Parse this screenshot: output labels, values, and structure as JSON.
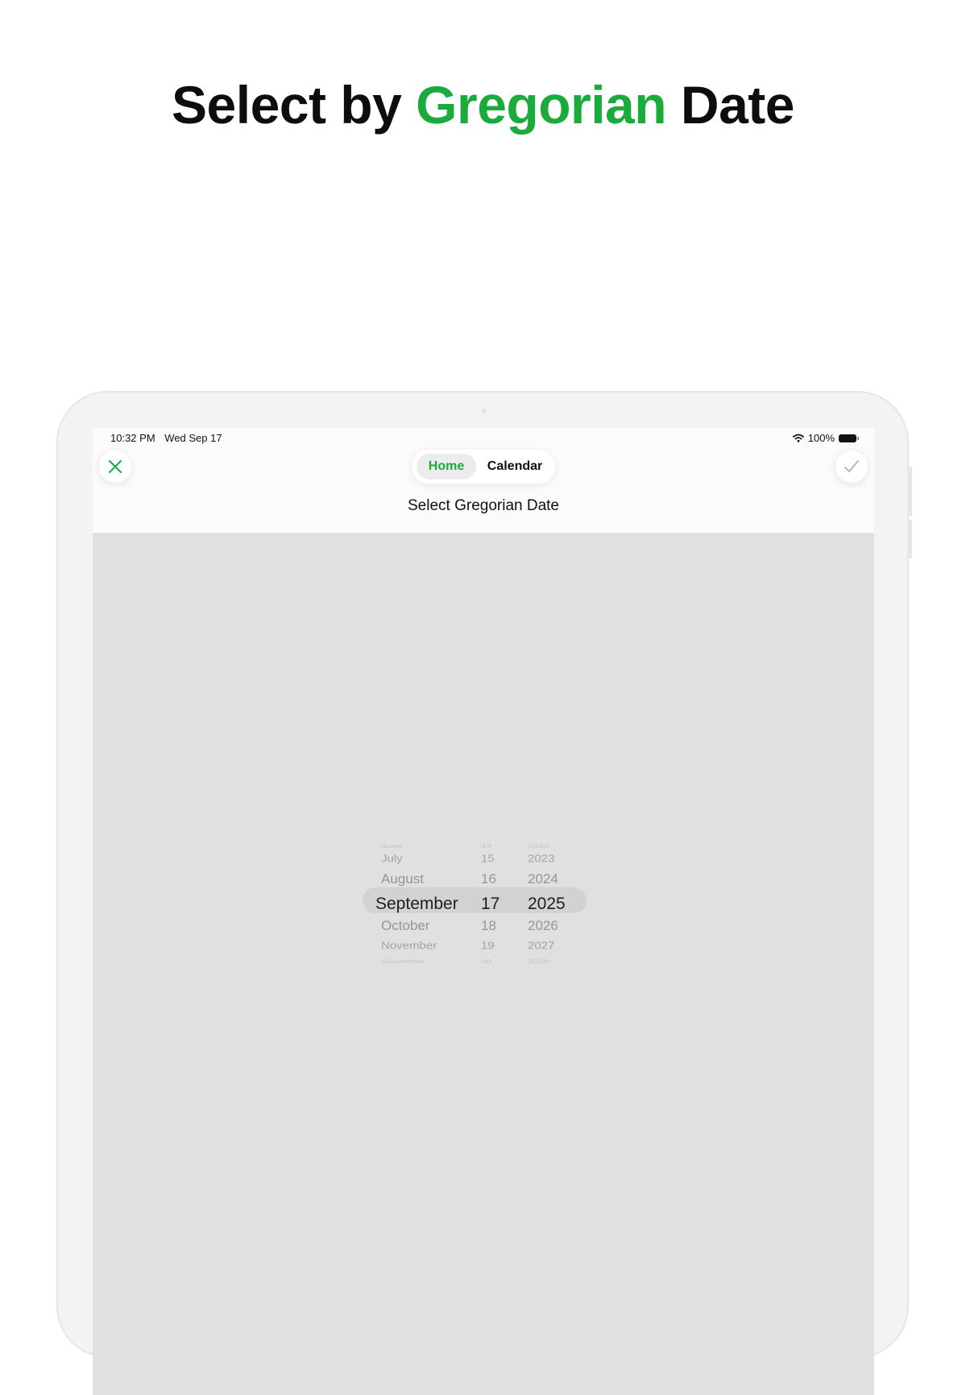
{
  "headline": {
    "before": "Select by ",
    "accent": "Gregorian",
    "after": " Date"
  },
  "status_bar": {
    "time": "10:32 PM",
    "date": "Wed Sep 17",
    "battery": "100%"
  },
  "nav": {
    "tabs": [
      {
        "label": "Home",
        "selected": true
      },
      {
        "label": "Calendar",
        "selected": false
      }
    ],
    "title": "Select Gregorian Date",
    "close_icon": "xmark-icon",
    "confirm_icon": "checkmark-icon"
  },
  "picker": {
    "months": [
      "June",
      "July",
      "August",
      "September",
      "October",
      "November",
      "December"
    ],
    "days": [
      "14",
      "15",
      "16",
      "17",
      "18",
      "19",
      "20"
    ],
    "years": [
      "2022",
      "2023",
      "2024",
      "2025",
      "2026",
      "2027",
      "2028"
    ],
    "selected": {
      "month": "September",
      "day": "17",
      "year": "2025"
    }
  },
  "colors": {
    "accent": "#1aab3c",
    "screen_bg": "#e0e0e1"
  }
}
